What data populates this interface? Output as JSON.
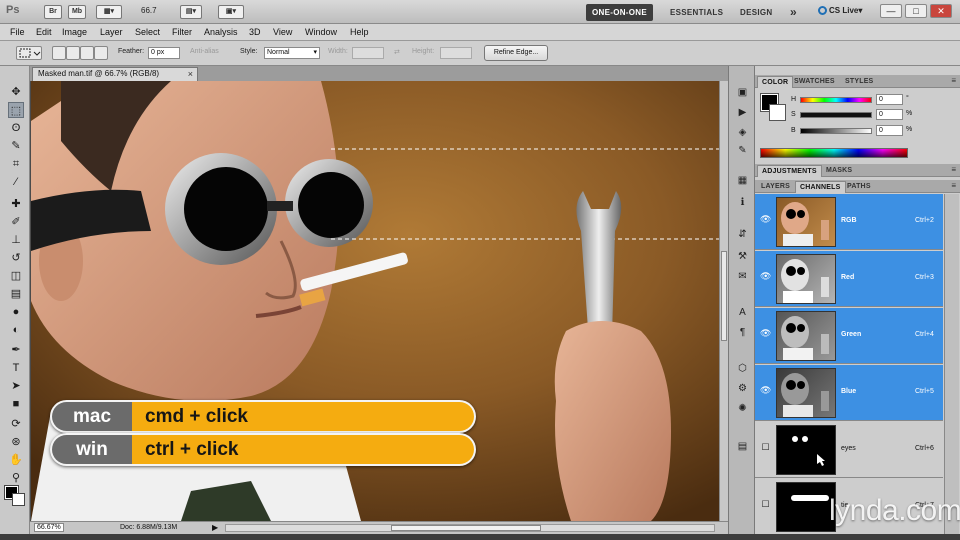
{
  "app": {
    "logo": "Ps",
    "bridge_label": "Br",
    "minibridge_label": "Mb",
    "zoom_value": "66.7",
    "workspaces": [
      "ONE-ON-ONE",
      "ESSENTIALS",
      "DESIGN"
    ],
    "active_workspace": "ONE-ON-ONE",
    "more_label": "»",
    "cs_live": "CS Live",
    "window_controls": [
      "—",
      "□",
      "✕"
    ]
  },
  "menu": [
    "File",
    "Edit",
    "Image",
    "Layer",
    "Select",
    "Filter",
    "Analysis",
    "3D",
    "View",
    "Window",
    "Help"
  ],
  "options_bar": {
    "feather_label": "Feather:",
    "feather_value": "0 px",
    "antialias_label": "Anti-alias",
    "style_label": "Style:",
    "style_value": "Normal",
    "width_label": "Width:",
    "height_label": "Height:",
    "refine_edge": "Refine Edge..."
  },
  "document": {
    "tab_title": "Masked man.tif @ 66.7% (RGB/8)",
    "tab_close": "×",
    "zoom": "66.67%",
    "doc_info": "Doc: 6.88M/9.13M"
  },
  "overlay": {
    "mac_label": "mac",
    "mac_keys": "cmd + click",
    "win_label": "win",
    "win_keys": "ctrl + click"
  },
  "color_panel": {
    "tabs": [
      "COLOR",
      "SWATCHES",
      "STYLES"
    ],
    "active_tab": "COLOR",
    "sliders": [
      {
        "label": "H",
        "value": "0",
        "unit": "°"
      },
      {
        "label": "S",
        "value": "0",
        "unit": "%"
      },
      {
        "label": "B",
        "value": "0",
        "unit": "%"
      }
    ]
  },
  "adjustments_panel": {
    "tabs": [
      "ADJUSTMENTS",
      "MASKS"
    ],
    "active_tab": "ADJUSTMENTS"
  },
  "channels_panel": {
    "tabs": [
      "LAYERS",
      "CHANNELS",
      "PATHS"
    ],
    "active_tab": "CHANNELS",
    "channels": [
      {
        "name": "RGB",
        "shortcut": "Ctrl+2",
        "selected": true
      },
      {
        "name": "Red",
        "shortcut": "Ctrl+3",
        "selected": true
      },
      {
        "name": "Green",
        "shortcut": "Ctrl+4",
        "selected": true
      },
      {
        "name": "Blue",
        "shortcut": "Ctrl+5",
        "selected": true
      },
      {
        "name": "eyes",
        "shortcut": "Ctrl+6",
        "selected": false
      },
      {
        "name": "tie",
        "shortcut": "Ctrl+7",
        "selected": false
      }
    ]
  },
  "watermark": "lynda.com",
  "colors": {
    "selection_blue": "#3d90e3",
    "overlay_orange": "#f5ac10",
    "overlay_gray": "#6b6b6b",
    "active_workspace_bg": "#3d3d3d"
  }
}
